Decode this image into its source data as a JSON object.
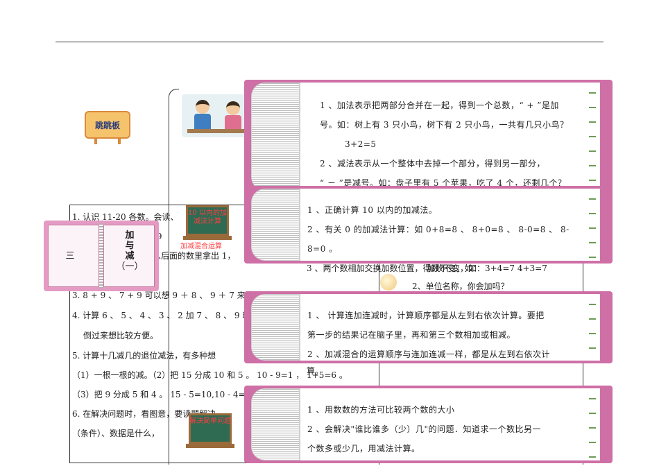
{
  "header_rule": true,
  "jump_board": {
    "label": "跳跳板"
  },
  "chapter": {
    "number": "三",
    "title_line1": "加",
    "title_line2": "与",
    "title_line3": "减",
    "title_line4": "（一）"
  },
  "left_list": {
    "l1": "1. 认识 11-20 各数。会读、",
    "l2": "算 9",
    "l3": "从后面的数里拿出 1，",
    "l4": "3. 8 + 9 、 7 + 9 可以想 9 ＋ 8 、 9 ＋ 7 来计",
    "l5": "4. 计算 6 、 5 、 4 、 3 、 2 加 7 、 8 、 9 时",
    "l6": "倒过来想比较方便。",
    "l7": "5. 计算十几减几的退位减法，有多种想",
    "l8": "（1）一根一根的减。（2）把 15 分成 10 和 5 。 10 - 9=1 ， 1+5=6 。",
    "l9": "（3）把 9 分成 5 和 4 。 15 - 5=10,10 - 4=",
    "l10": "6. 在解决问题时，看图意，要读题解决",
    "l11": "（条件）、数据是什么，"
  },
  "boards": {
    "b1": "10 以内的加减法计算",
    "b2": "加减混合运算",
    "b3": "解决简单问题"
  },
  "overlap": {
    "commute": "加数不变，如：3+4=7   4+3=7",
    "units": "2、单位名称，你会加吗？"
  },
  "notebook1": {
    "line1": "1 、加法表示把两部分合并在一起，得到一个总数，“ + ”是加",
    "line2": "号。如：树上有 3 只小鸟，树下有 2 只小鸟，一共有几只小鸟？",
    "line3": "3+2=5",
    "line4": "2 、减法表示从一个整体中去掉一个部分，得到另一部分，",
    "line5": "“ － ”是减号。如：盘子里有 5 个苹果，吃了 4 个，还剩几个？"
  },
  "notebook2": {
    "line1": "1 、正确计算 10 以内的加减法。",
    "line2": "2 、有关 0 的加减法计算：如 0+8=8 、 8+0=8 、 8-0=8 、 8-",
    "line3": "8=0 。",
    "line4": "3 、两个数相加交换加数位置，得数不变，如："
  },
  "notebook3": {
    "line1": "1 、 计算连加连减时，计算顺序都是从左到右依次计算。要把",
    "line2": "第一步的结果记在脑子里，再和第三个数相加或相减。",
    "line3": "2 、加减混合的运算顺序与连加连减一样，都是从左到右依次计",
    "line4": "算。"
  },
  "notebook4": {
    "line1": "1 、用数数的方法可比较两个数的大小",
    "line2": "2 、会解决\"谁比谁多（少）几\"的问题．知道求一个数比另一",
    "line3": "个数多或少几，用减法计算。"
  }
}
